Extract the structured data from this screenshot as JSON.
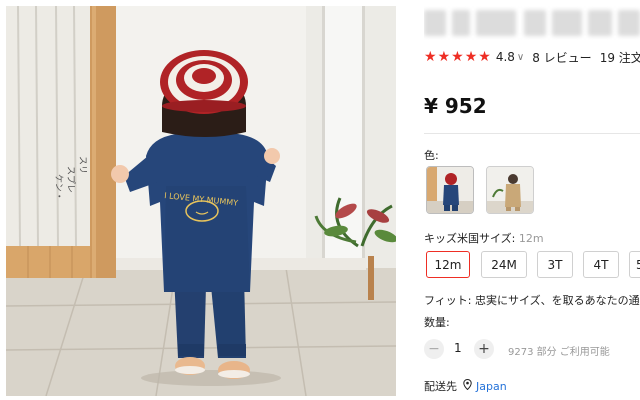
{
  "product": {
    "rating_value": "4.8",
    "reviews_text": "8 レビュー",
    "orders_text": "19 注文",
    "price": "¥ 952"
  },
  "color_section": {
    "label": "色:",
    "swatches": [
      "denim-jumpsuit-navy",
      "denim-jumpsuit-khaki"
    ]
  },
  "size_section": {
    "label": "キッズ米国サイズ:",
    "selected_value": "12m",
    "options": [
      "12m",
      "24M",
      "3T",
      "4T",
      "5"
    ]
  },
  "fit_note": "フィット: 忠実にサイズ、を取るあなたの通常の",
  "quantity": {
    "label": "数量:",
    "value": "1",
    "minus": "−",
    "plus": "+",
    "stock_text": "9273 部分 ご利用可能"
  },
  "shipping": {
    "label": "配送先",
    "destination": "Japan"
  },
  "photo": {
    "shirt_text": "I LOVE MY MUMMY",
    "colors": {
      "denim": "#24406f",
      "beret_red": "#b02326",
      "wall": "#f4f3f0",
      "floor": "#d8d3c9"
    }
  },
  "theme": {
    "accent": "#ee2e24",
    "link": "#2673d9"
  }
}
